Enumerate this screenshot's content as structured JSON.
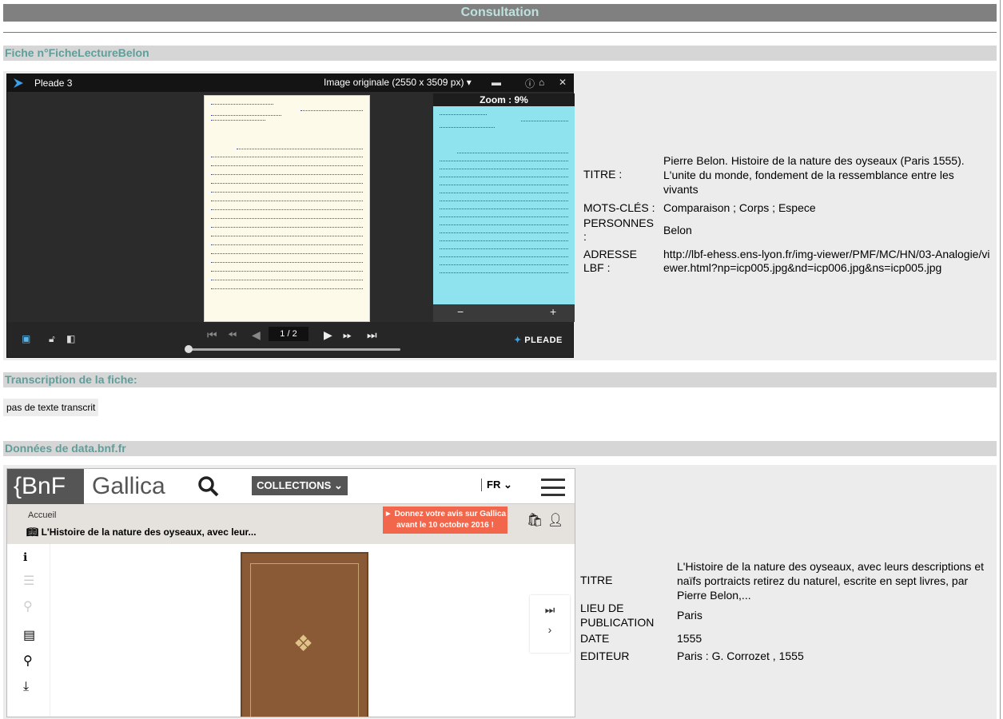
{
  "page": {
    "title": "Consultation",
    "sections": {
      "fiche": "Fiche n°FicheLectureBelon",
      "transcription": "Transcription de la fiche:",
      "bnf": "Données de data.bnf.fr"
    }
  },
  "viewer": {
    "app_name": "Pleade 3",
    "image_select": "Image originale (2550 x 3509 px)",
    "zoom": "Zoom : 9%",
    "page_indicator": "1 / 2",
    "brand": "PLEADE",
    "icons": [
      "pleade-logo-icon",
      "print-icon",
      "help-icon",
      "home-icon",
      "close-icon",
      "zoom-out-icon",
      "zoom-in-icon",
      "layers-icon",
      "unlock-icon",
      "toggle-thumb-icon",
      "first-page-icon",
      "fast-back-icon",
      "prev-icon",
      "next-icon",
      "fast-forward-icon",
      "last-page-icon"
    ]
  },
  "fiche_meta": {
    "titre_label": "TITRE :",
    "titre_value": "Pierre Belon. Histoire de la nature des oyseaux (Paris 1555). L'unite du monde, fondement de la ressemblance entre les vivants",
    "motscles_label": "MOTS-CLÉS :",
    "motscles_value": "Comparaison ; Corps ; Espece",
    "personnes_label": "PERSONNES :",
    "personnes_value": "Belon",
    "adresse_label": "ADRESSE LBF :",
    "adresse_value": "http://lbf-ehess.ens-lyon.fr/img-viewer/PMF/MC/HN/03-Analogie/viewer.html?np=icp005.jpg&nd=icp006.jpg&ns=icp005.jpg"
  },
  "transcription": {
    "text": "pas de texte transcrit"
  },
  "gallica": {
    "logo_bnf": "{BnF",
    "logo_gallica": "Gallica",
    "collections_label": "COLLECTIONS",
    "lang_label": "FR",
    "breadcrumb_home": "Accueil",
    "book_title": "L'Histoire de la nature des oyseaux, avec leur...",
    "promo_line1": "► Donnez votre avis sur Gallica",
    "promo_line2": "avant le 10 octobre 2016 !"
  },
  "bnf_meta": {
    "titre_label": "TITRE",
    "titre_value": "L'Histoire de la nature des oyseaux, avec leurs descriptions et naïfs portraicts retirez du naturel, escrite en sept livres, par Pierre Belon,...",
    "lieu_label": "LIEU DE PUBLICATION",
    "lieu_value": "Paris",
    "date_label": "DATE",
    "date_value": "1555",
    "editeur_label": "EDITEUR",
    "editeur_value": "Paris : G. Corrozet , 1555"
  },
  "colors": {
    "header_bg": "#808080",
    "header_text": "#bde2de",
    "section_text": "#5f9e9a",
    "promo": "#f2674b"
  }
}
